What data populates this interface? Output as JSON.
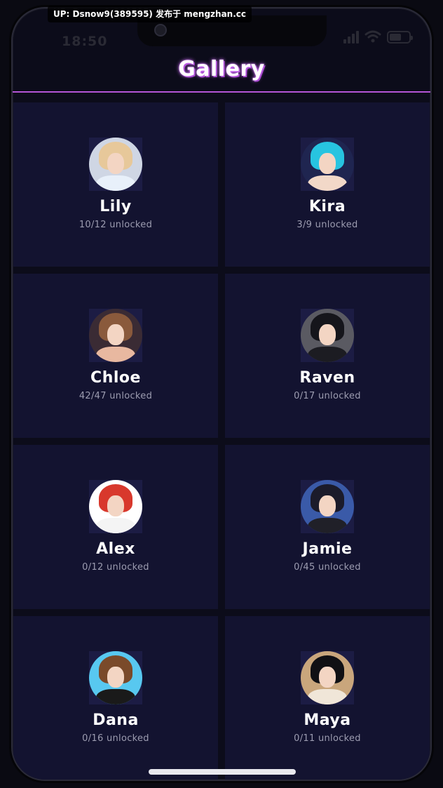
{
  "watermark": "UP: Dsnow9(389595) 发布于 mengzhan.cc",
  "status_bar": {
    "time": "18:50"
  },
  "header": {
    "title": "Gallery"
  },
  "theme": {
    "accent": "#b455d6",
    "card_bg": "#131330",
    "bg": "#0c0c1a"
  },
  "characters": [
    {
      "name": "Lily",
      "progress": "10/12 unlocked",
      "hair": "#e7c89a",
      "bg": "#cfd6e4",
      "outfit": "#e8f0fa"
    },
    {
      "name": "Kira",
      "progress": "3/9 unlocked",
      "hair": "#27c4e0",
      "bg": "#1f2550",
      "outfit": "#f2d8c8"
    },
    {
      "name": "Chloe",
      "progress": "42/47 unlocked",
      "hair": "#8a5a3c",
      "bg": "#3a2b34",
      "outfit": "#e8b8a0"
    },
    {
      "name": "Raven",
      "progress": "0/17 unlocked",
      "hair": "#15151b",
      "bg": "#5a5a62",
      "outfit": "#1c1c22"
    },
    {
      "name": "Alex",
      "progress": "0/12 unlocked",
      "hair": "#d8382c",
      "bg": "#ffffff",
      "outfit": "#f4f4f4"
    },
    {
      "name": "Jamie",
      "progress": "0/45 unlocked",
      "hair": "#1b1b2a",
      "bg": "#3a5aa8",
      "outfit": "#202028"
    },
    {
      "name": "Dana",
      "progress": "0/16 unlocked",
      "hair": "#7a4a2a",
      "bg": "#58c8f0",
      "outfit": "#1a1a1a"
    },
    {
      "name": "Maya",
      "progress": "0/11 unlocked",
      "hair": "#101014",
      "bg": "#c9a67c",
      "outfit": "#f0e6d8"
    }
  ]
}
